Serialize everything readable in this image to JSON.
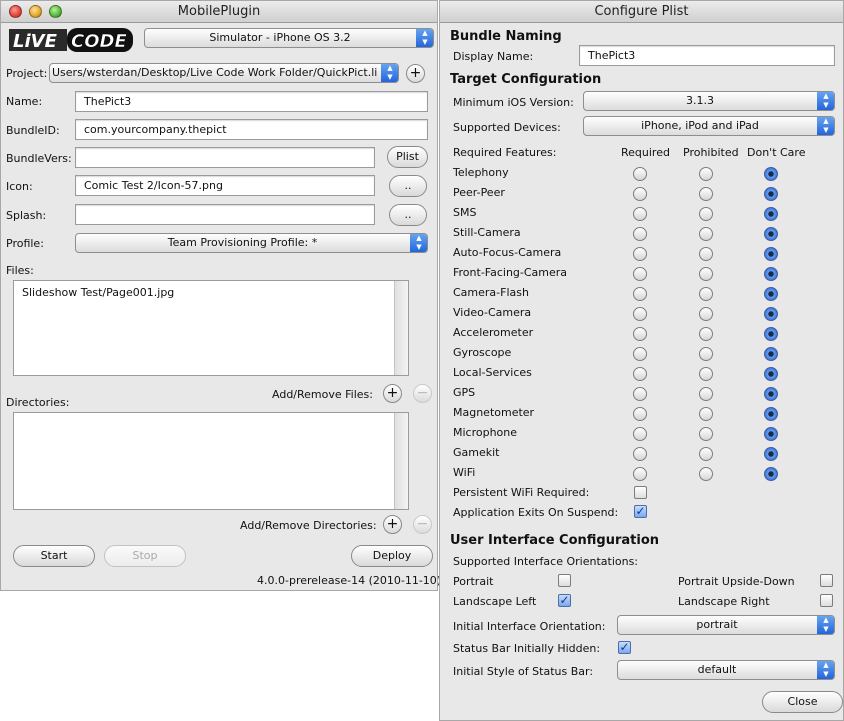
{
  "left_window": {
    "title": "MobilePlugin",
    "logo_text": "LiVE CODE",
    "simulator_select": "Simulator - iPhone OS 3.2",
    "project_label": "Project:",
    "project_path": "Users/wsterdan/Desktop/Live Code Work Folder/QuickPict.li",
    "name_label": "Name:",
    "name_value": "ThePict3",
    "bundleid_label": "BundleID:",
    "bundleid_value": "com.yourcompany.thepict",
    "bundlevers_label": "BundleVers:",
    "bundlevers_value": "",
    "plist_button": "Plist",
    "icon_label": "Icon:",
    "icon_value": "Comic Test 2/Icon-57.png",
    "splash_label": "Splash:",
    "splash_value": "",
    "browse_button": "..",
    "profile_label": "Profile:",
    "profile_value": "Team Provisioning Profile: *",
    "files_label": "Files:",
    "files": [
      "Slideshow Test/Page001.jpg"
    ],
    "add_remove_files_label": "Add/Remove Files:",
    "directories_label": "Directories:",
    "add_remove_directories_label": "Add/Remove Directories:",
    "add_symbol": "+",
    "remove_symbol": "−",
    "start_button": "Start",
    "stop_button": "Stop",
    "deploy_button": "Deploy",
    "version": "4.0.0-prerelease-14 (2010-11-10)"
  },
  "right_window": {
    "title": "Configure Plist",
    "bundle_naming_header": "Bundle  Naming",
    "display_name_label": "Display Name:",
    "display_name_value": "ThePict3",
    "target_config_header": "Target Configuration",
    "min_ios_label": "Minimum iOS Version:",
    "min_ios_value": "3.1.3",
    "supported_devices_label": "Supported Devices:",
    "supported_devices_value": "iPhone, iPod and iPad",
    "required_features_label": "Required Features:",
    "col_required": "Required",
    "col_prohibited": "Prohibited",
    "col_dont_care": "Don't Care",
    "features": [
      {
        "name": "Telephony",
        "selected": "dont_care"
      },
      {
        "name": "Peer-Peer",
        "selected": "dont_care"
      },
      {
        "name": "SMS",
        "selected": "dont_care"
      },
      {
        "name": "Still-Camera",
        "selected": "dont_care"
      },
      {
        "name": "Auto-Focus-Camera",
        "selected": "dont_care"
      },
      {
        "name": "Front-Facing-Camera",
        "selected": "dont_care"
      },
      {
        "name": "Camera-Flash",
        "selected": "dont_care"
      },
      {
        "name": "Video-Camera",
        "selected": "dont_care"
      },
      {
        "name": "Accelerometer",
        "selected": "dont_care"
      },
      {
        "name": "Gyroscope",
        "selected": "dont_care"
      },
      {
        "name": "Local-Services",
        "selected": "dont_care"
      },
      {
        "name": "GPS",
        "selected": "dont_care"
      },
      {
        "name": "Magnetometer",
        "selected": "dont_care"
      },
      {
        "name": "Microphone",
        "selected": "dont_care"
      },
      {
        "name": "Gamekit",
        "selected": "dont_care"
      },
      {
        "name": "WiFi",
        "selected": "dont_care"
      }
    ],
    "persistent_wifi_label": "Persistent WiFi Required:",
    "persistent_wifi_checked": false,
    "exits_on_suspend_label": "Application Exits On Suspend:",
    "exits_on_suspend_checked": true,
    "ui_config_header": "User Interface Configuration",
    "supported_orientations_label": "Supported Interface Orientations:",
    "portrait_label": "Portrait",
    "portrait_checked": false,
    "portrait_upside_down_label": "Portrait Upside-Down",
    "portrait_upside_down_checked": false,
    "landscape_left_label": "Landscape Left",
    "landscape_left_checked": true,
    "landscape_right_label": "Landscape Right",
    "landscape_right_checked": false,
    "initial_orientation_label": "Initial Interface Orientation:",
    "initial_orientation_value": "portrait",
    "status_bar_hidden_label": "Status Bar Initially Hidden:",
    "status_bar_hidden_checked": true,
    "status_bar_style_label": "Initial Style of Status Bar:",
    "status_bar_style_value": "default",
    "close_button": "Close"
  },
  "colors": {
    "window_bg": "#e8e8e8",
    "accent_blue": "#2c6ad8",
    "close_light": "#e0443a",
    "minimize_light": "#e3a72a",
    "zoom_light": "#56b83a"
  },
  "icons": {
    "popup_arrows": "up-down-chevron-icon",
    "check": "checkmark-icon",
    "radio": "radio-dot-icon"
  }
}
